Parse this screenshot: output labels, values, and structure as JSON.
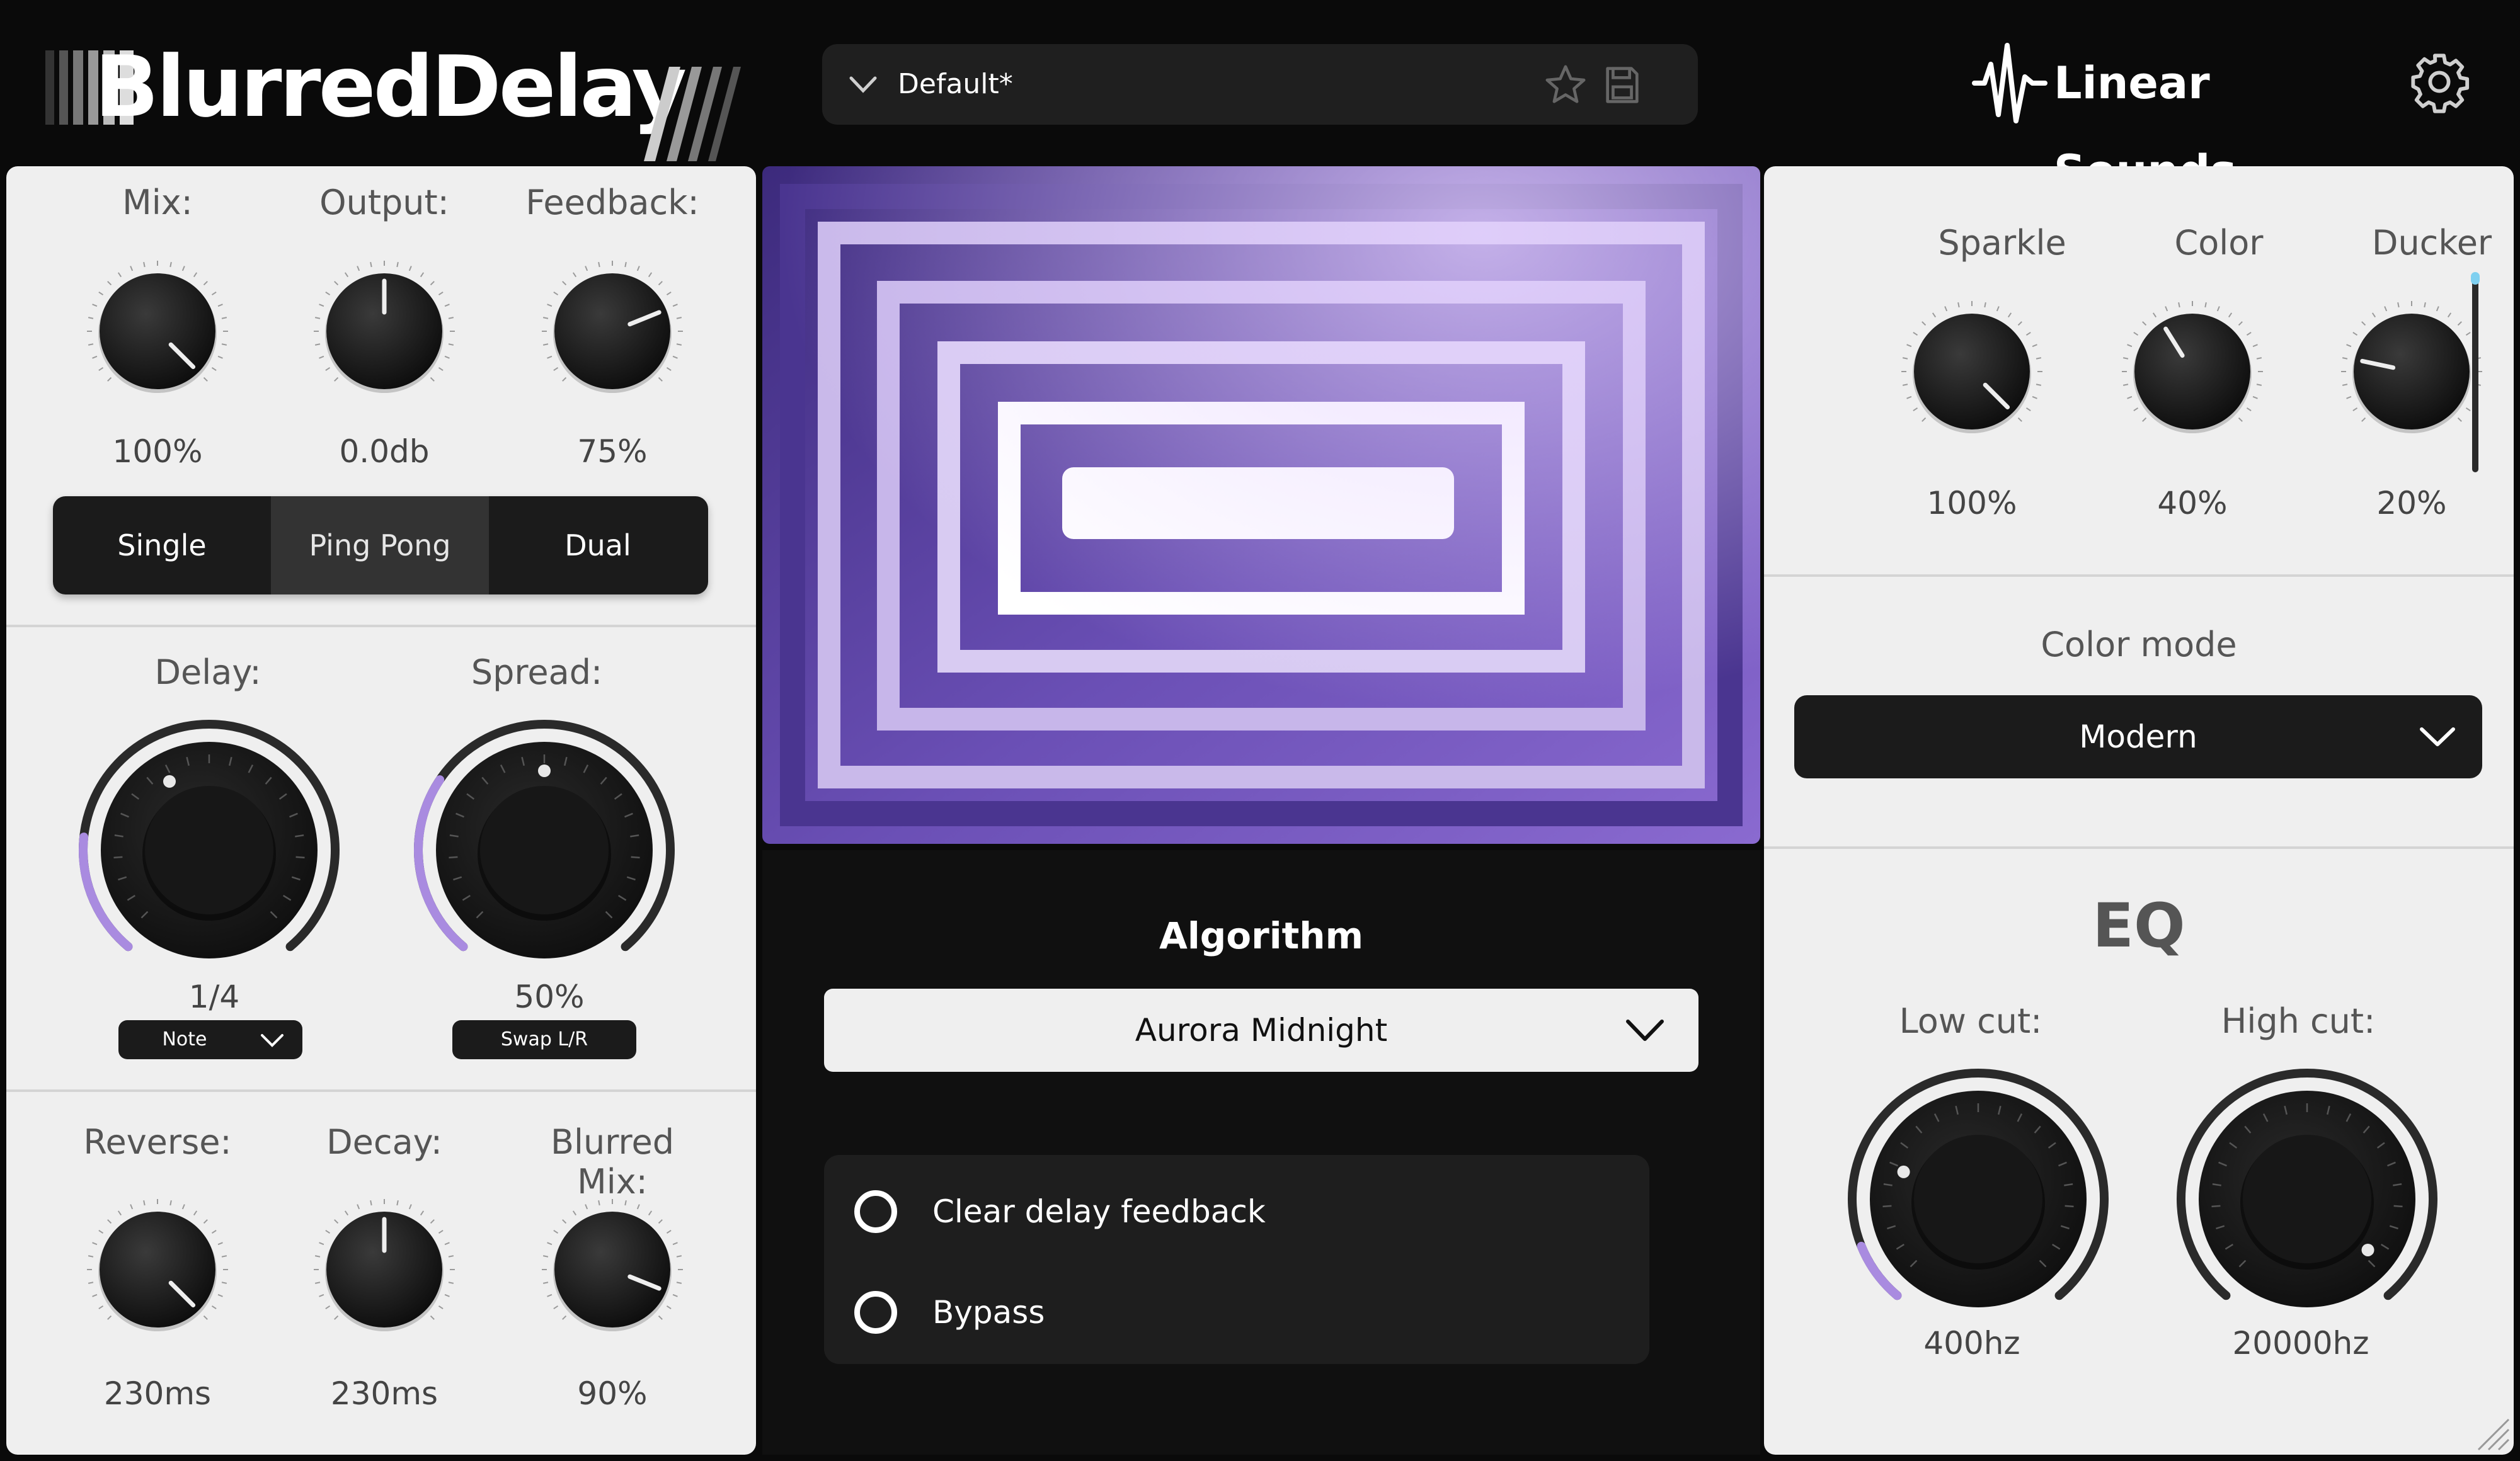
{
  "header": {
    "app_title": "BlurredDelay",
    "preset_name": "Default*",
    "brand": "Linear Sounds"
  },
  "top_knobs": [
    {
      "label": "Mix:",
      "value": "100%"
    },
    {
      "label": "Output:",
      "value": "0.0db"
    },
    {
      "label": "Feedback:",
      "value": "75%"
    }
  ],
  "modes": [
    "Single",
    "Ping Pong",
    "Dual"
  ],
  "active_mode": "Ping Pong",
  "delay": {
    "label": "Delay:",
    "value": "1/4",
    "button": "Note"
  },
  "spread": {
    "label": "Spread:",
    "value": "50%",
    "button": "Swap L/R"
  },
  "bottom_knobs": [
    {
      "label": "Reverse:",
      "value": "230ms"
    },
    {
      "label": "Decay:",
      "value": "230ms"
    },
    {
      "label": "Blurred Mix:",
      "value": "90%"
    }
  ],
  "algorithm": {
    "title": "Algorithm",
    "selected": "Aurora Midnight"
  },
  "options": [
    {
      "label": "Clear delay feedback",
      "checked": false
    },
    {
      "label": "Bypass",
      "checked": false
    }
  ],
  "character_knobs": [
    {
      "label": "Sparkle",
      "value": "100%"
    },
    {
      "label": "Color",
      "value": "40%"
    },
    {
      "label": "Ducker",
      "value": "20%"
    }
  ],
  "color_mode": {
    "label": "Color mode",
    "selected": "Modern"
  },
  "eq": {
    "title": "EQ",
    "low_cut": {
      "label": "Low cut:",
      "value": "400hz"
    },
    "high_cut": {
      "label": "High cut:",
      "value": "20000hz"
    }
  },
  "colors": {
    "accent": "#9b7fd8",
    "visual_purple": "#6a4fb5",
    "panel": "#efefef",
    "dark": "#1b1b1b"
  }
}
